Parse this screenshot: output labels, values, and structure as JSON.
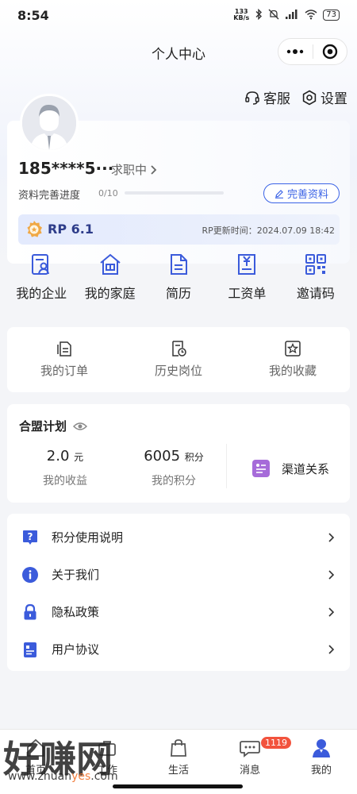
{
  "status_bar": {
    "time": "8:54",
    "net_speed_value": "133",
    "net_speed_unit": "KB/s",
    "battery": "73"
  },
  "nav": {
    "title": "个人中心"
  },
  "header_links": {
    "service": "客服",
    "settings": "设置"
  },
  "profile": {
    "username": "185****5···",
    "job_status": "求职中",
    "progress_label": "资料完善进度",
    "progress_value": "0/10",
    "progress_fraction": 0,
    "complete_button": "完善资料",
    "rp_value": "RP 6.1",
    "rp_update": "RP更新时间：2024.07.09 18:42"
  },
  "quick_actions": [
    {
      "label": "我的企业",
      "icon": "enterprise-icon"
    },
    {
      "label": "我的家庭",
      "icon": "home-icon"
    },
    {
      "label": "简历",
      "icon": "resume-icon"
    },
    {
      "label": "工资单",
      "icon": "payslip-icon"
    },
    {
      "label": "邀请码",
      "icon": "qrcode-icon"
    }
  ],
  "orders": [
    {
      "label": "我的订单",
      "icon": "order-icon"
    },
    {
      "label": "历史岗位",
      "icon": "history-icon"
    },
    {
      "label": "我的收藏",
      "icon": "favorite-icon"
    }
  ],
  "alliance": {
    "title": "合盟计划",
    "income_value": "2.0",
    "income_unit": "元",
    "income_label": "我的收益",
    "points_value": "6005",
    "points_unit": "积分",
    "points_label": "我的积分",
    "channel_label": "渠道关系"
  },
  "menu": [
    {
      "label": "积分使用说明",
      "icon": "question-icon"
    },
    {
      "label": "关于我们",
      "icon": "info-icon"
    },
    {
      "label": "隐私政策",
      "icon": "lock-icon"
    },
    {
      "label": "用户协议",
      "icon": "document-icon"
    }
  ],
  "tabs": [
    {
      "label": "首页"
    },
    {
      "label": "工作"
    },
    {
      "label": "生活"
    },
    {
      "label": "消息",
      "badge": "1119"
    },
    {
      "label": "我的"
    }
  ],
  "watermark": {
    "big": "好赚网",
    "small_a": "www.zhuan",
    "small_b": "yes",
    "small_c": ".com"
  },
  "colors": {
    "accent": "#3b63e6",
    "badge": "#f2533d",
    "channel_icon": "#a66bd9"
  }
}
